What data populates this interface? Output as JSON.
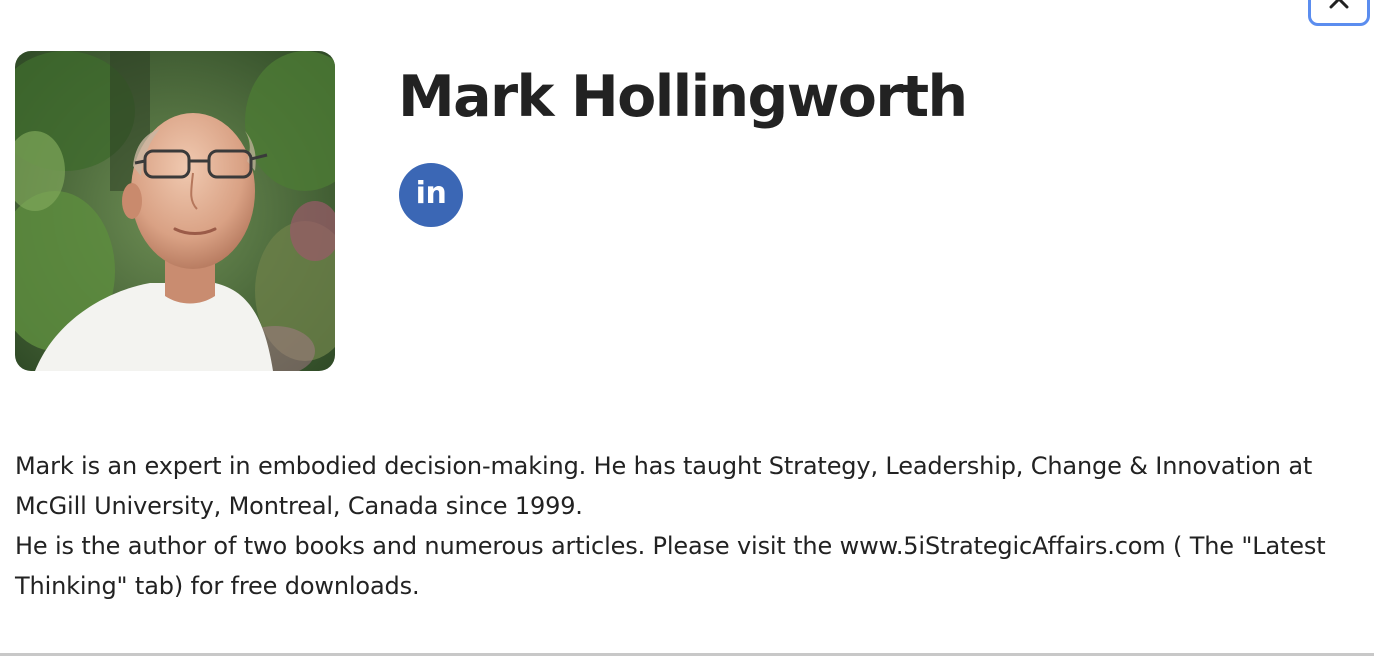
{
  "profile": {
    "name": "Mark Hollingworth",
    "linkedin_label": "in",
    "bio": [
      "Mark is an expert in embodied decision-making. He has taught Strategy, Leadership, Change & Innovation at McGill University, Montreal, Canada since 1999.",
      "He is the author of two books and numerous articles. Please visit the www.5iStrategicAffairs.com ( The \"Latest Thinking\" tab) for free downloads."
    ]
  },
  "icons": {
    "close": "close-icon",
    "linkedin": "linkedin-icon"
  },
  "colors": {
    "linkedin_blue": "#3b67b5",
    "close_outline": "#5b8def",
    "text": "#222222",
    "divider": "#c8c8c8"
  }
}
